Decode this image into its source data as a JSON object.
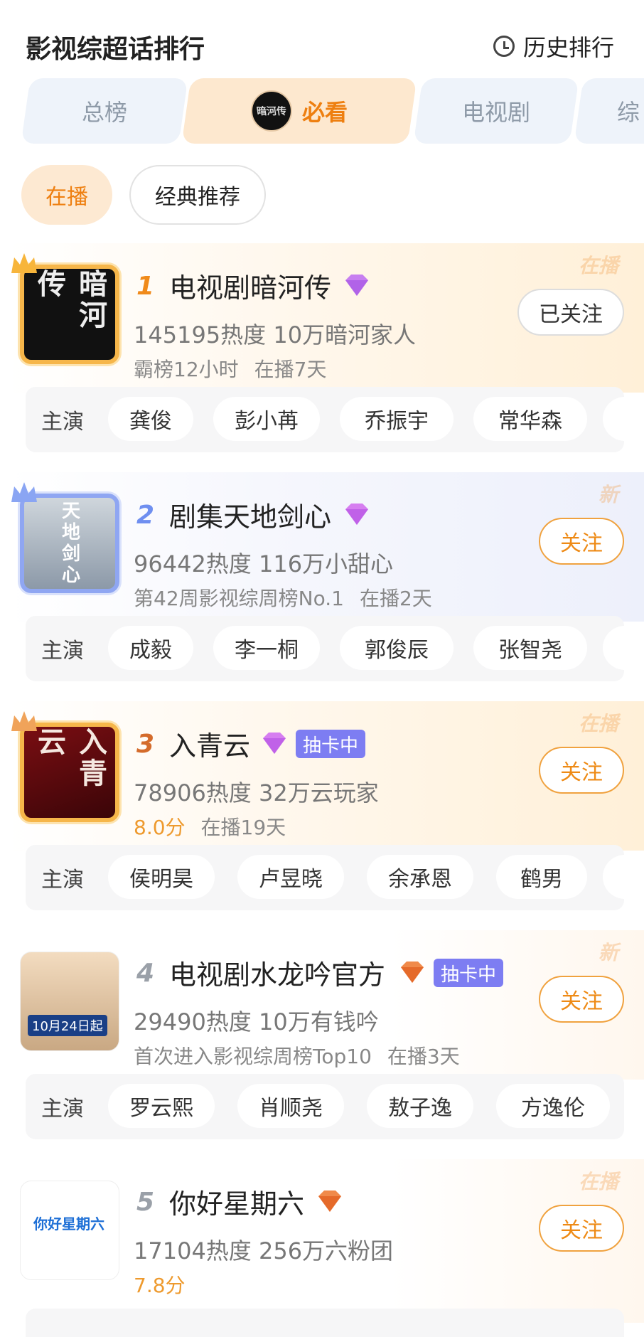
{
  "header": {
    "title": "影视综超话排行",
    "history_label": "历史排行"
  },
  "tabs": [
    {
      "label": "总榜"
    },
    {
      "label": "必看",
      "avatar_text": "暗河传"
    },
    {
      "label": "电视剧"
    },
    {
      "label": "综"
    }
  ],
  "filters": [
    {
      "label": "在播"
    },
    {
      "label": "经典推荐"
    }
  ],
  "cast_label": "主演",
  "items": [
    {
      "rank": "1",
      "name": "电视剧暗河传",
      "poster_text": "暗河传",
      "badge": "",
      "stats": "145195热度 10万暗河家人",
      "score": "",
      "meta1": "霸榜12小时",
      "meta2": "在播7天",
      "follow": "已关注",
      "status": "在播",
      "cast": [
        "龚俊",
        "彭小苒",
        "乔振宇",
        "常华森"
      ]
    },
    {
      "rank": "2",
      "name": "剧集天地剑心",
      "poster_text": "天地剑心",
      "badge": "",
      "stats": "96442热度 116万小甜心",
      "score": "",
      "meta1": "第42周影视综周榜No.1",
      "meta2": "在播2天",
      "follow": "关注",
      "status": "新",
      "cast": [
        "成毅",
        "李一桐",
        "郭俊辰",
        "张智尧"
      ]
    },
    {
      "rank": "3",
      "name": "入青云",
      "poster_text": "入青云",
      "badge": "抽卡中",
      "stats": "78906热度 32万云玩家",
      "score": "8.0分",
      "meta1": "",
      "meta2": "在播19天",
      "follow": "关注",
      "status": "在播",
      "cast": [
        "侯明昊",
        "卢昱晓",
        "余承恩",
        "鹤男"
      ]
    },
    {
      "rank": "4",
      "name": "电视剧水龙吟官方",
      "poster_text": "10月24日起",
      "badge": "抽卡中",
      "stats": "29490热度 10万有钱吟",
      "score": "",
      "meta1": "首次进入影视综周榜Top10",
      "meta2": "在播3天",
      "follow": "关注",
      "status": "新",
      "cast": [
        "罗云熙",
        "肖顺尧",
        "敖子逸",
        "方逸伦"
      ]
    },
    {
      "rank": "5",
      "name": "你好星期六",
      "poster_text": "你好星期六",
      "badge": "",
      "stats": "17104热度 256万六粉团",
      "score": "7.8分",
      "meta1": "",
      "meta2": "",
      "follow": "关注",
      "status": "在播",
      "cast": []
    }
  ],
  "colors": {
    "accent": "#ee7f10",
    "follow_border": "#f0a23f",
    "rank1": "#f08a1a",
    "rank2": "#6f8ff0",
    "badge": "#7d7df2",
    "score": "#ee9a2e"
  },
  "icons": [
    "clock-icon",
    "crown-icon",
    "vip-diamond-icon"
  ]
}
